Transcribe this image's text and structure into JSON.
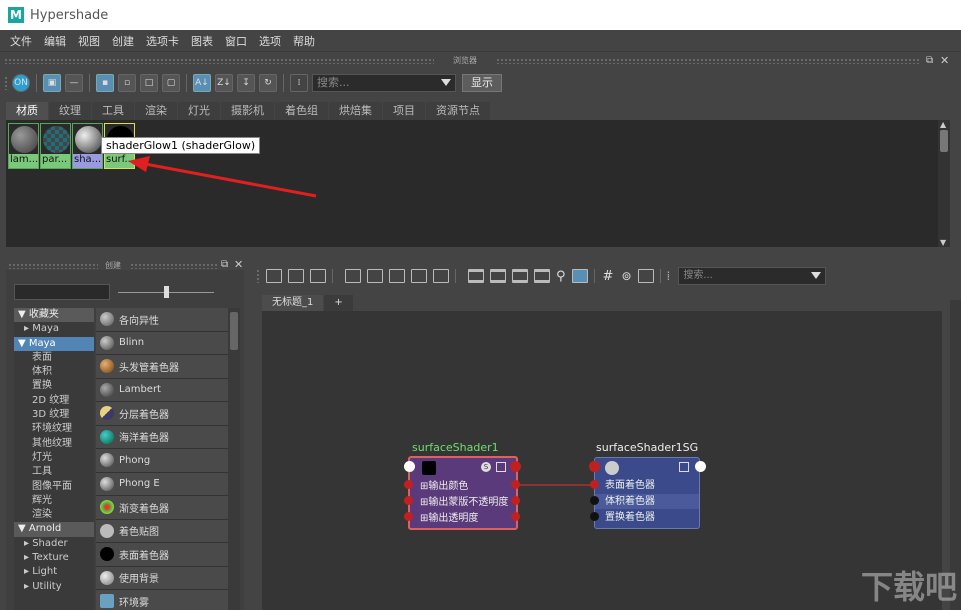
{
  "window": {
    "title": "Hypershade",
    "logo_letter": "M"
  },
  "menu": [
    "文件",
    "编辑",
    "视图",
    "创建",
    "选项卡",
    "图表",
    "窗口",
    "选项",
    "帮助"
  ],
  "browser": {
    "panel_title": "浏览器",
    "search_placeholder": "搜索...",
    "show_button": "显示",
    "tabs": [
      "材质",
      "纹理",
      "工具",
      "渲染",
      "灯光",
      "摄影机",
      "着色组",
      "烘焙集",
      "项目",
      "资源节点"
    ],
    "active_tab": 0,
    "swatches": [
      {
        "label": "lam...",
        "ball_color": "#555555",
        "label_bg": "#7ac97a"
      },
      {
        "label": "par...",
        "ball_color": "#1f6f7a",
        "label_bg": "#7ac97a"
      },
      {
        "label": "sha...",
        "ball_color": "#888888",
        "label_bg": "#9a9ae0"
      },
      {
        "label": "surf...",
        "ball_color": "#000000",
        "label_bg": "#7ac97a"
      }
    ],
    "tooltip": "shaderGlow1 (shaderGlow)"
  },
  "create": {
    "panel_title": "创建",
    "tree": [
      {
        "label": "收藏夹",
        "kind": "hdr"
      },
      {
        "label": "Maya",
        "kind": "sub"
      },
      {
        "label": "Maya",
        "kind": "sel"
      },
      {
        "label": "表面",
        "kind": "child"
      },
      {
        "label": "体积",
        "kind": "child"
      },
      {
        "label": "置换",
        "kind": "child"
      },
      {
        "label": "2D 纹理",
        "kind": "child"
      },
      {
        "label": "3D 纹理",
        "kind": "child"
      },
      {
        "label": "环境纹理",
        "kind": "child"
      },
      {
        "label": "其他纹理",
        "kind": "child"
      },
      {
        "label": "灯光",
        "kind": "child"
      },
      {
        "label": "工具",
        "kind": "child"
      },
      {
        "label": "图像平面",
        "kind": "child"
      },
      {
        "label": "辉光",
        "kind": "child"
      },
      {
        "label": "渲染",
        "kind": "child"
      },
      {
        "label": "Arnold",
        "kind": "hdr"
      },
      {
        "label": "Shader",
        "kind": "sub"
      },
      {
        "label": "Texture",
        "kind": "sub"
      },
      {
        "label": "Light",
        "kind": "sub"
      },
      {
        "label": "Utility",
        "kind": "sub"
      }
    ],
    "nodes": [
      {
        "label": "各向异性",
        "color": "#666666"
      },
      {
        "label": "Blinn",
        "color": "#555555"
      },
      {
        "label": "头发管着色器",
        "color": "#b07030"
      },
      {
        "label": "Lambert",
        "color": "#555555"
      },
      {
        "label": "分层着色器",
        "color": "#c8b060"
      },
      {
        "label": "海洋着色器",
        "color": "#1f7f8a"
      },
      {
        "label": "Phong",
        "color": "#555555"
      },
      {
        "label": "Phong E",
        "color": "#555555"
      },
      {
        "label": "渐变着色器",
        "color": "#d0a030"
      },
      {
        "label": "着色贴图",
        "color": "#bbbbbb"
      },
      {
        "label": "表面着色器",
        "color": "#000000"
      },
      {
        "label": "使用背景",
        "color": "#aaaaaa"
      },
      {
        "label": "环境雾",
        "color": "#6aa0c0"
      }
    ]
  },
  "graph": {
    "search_placeholder": "搜索...",
    "tabs": [
      "无标题_1",
      "+"
    ],
    "node_a": {
      "title": "surfaceShader1",
      "rows": [
        "输出颜色",
        "输出蒙版不透明度",
        "输出透明度"
      ]
    },
    "node_b": {
      "title": "surfaceShader1SG",
      "rows": [
        "表面着色器",
        "体积着色器",
        "置换着色器"
      ]
    }
  },
  "watermark": "下载吧"
}
